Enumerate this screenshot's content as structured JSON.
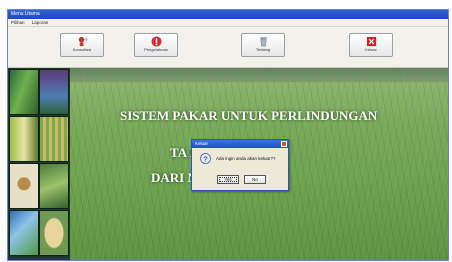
{
  "window": {
    "title": "Menu Utama"
  },
  "menu": {
    "items": [
      "Pilihan",
      "Laporan"
    ]
  },
  "toolbar": {
    "buttons": [
      {
        "label": "Konsultasi",
        "icon": "question-person-icon",
        "color": "#c0392b"
      },
      {
        "label": "Pengetahuan",
        "icon": "warning-icon",
        "color": "#d32f2f"
      },
      {
        "label": "Tentang",
        "icon": "trash-icon",
        "color": "#7c8a99"
      },
      {
        "label": "Keluar",
        "icon": "exit-icon",
        "color": "#c62828"
      }
    ]
  },
  "main": {
    "line1": "SISTEM PAKAR UNTUK PERLINDUNGAN",
    "line2": "TA                     I IR64",
    "line3": "DARI                    NYAKIT"
  },
  "dialog": {
    "title": "Keluar",
    "message": "Ada ingin anda akan keluar??",
    "yes_label": "Yes",
    "no_label": "No"
  }
}
